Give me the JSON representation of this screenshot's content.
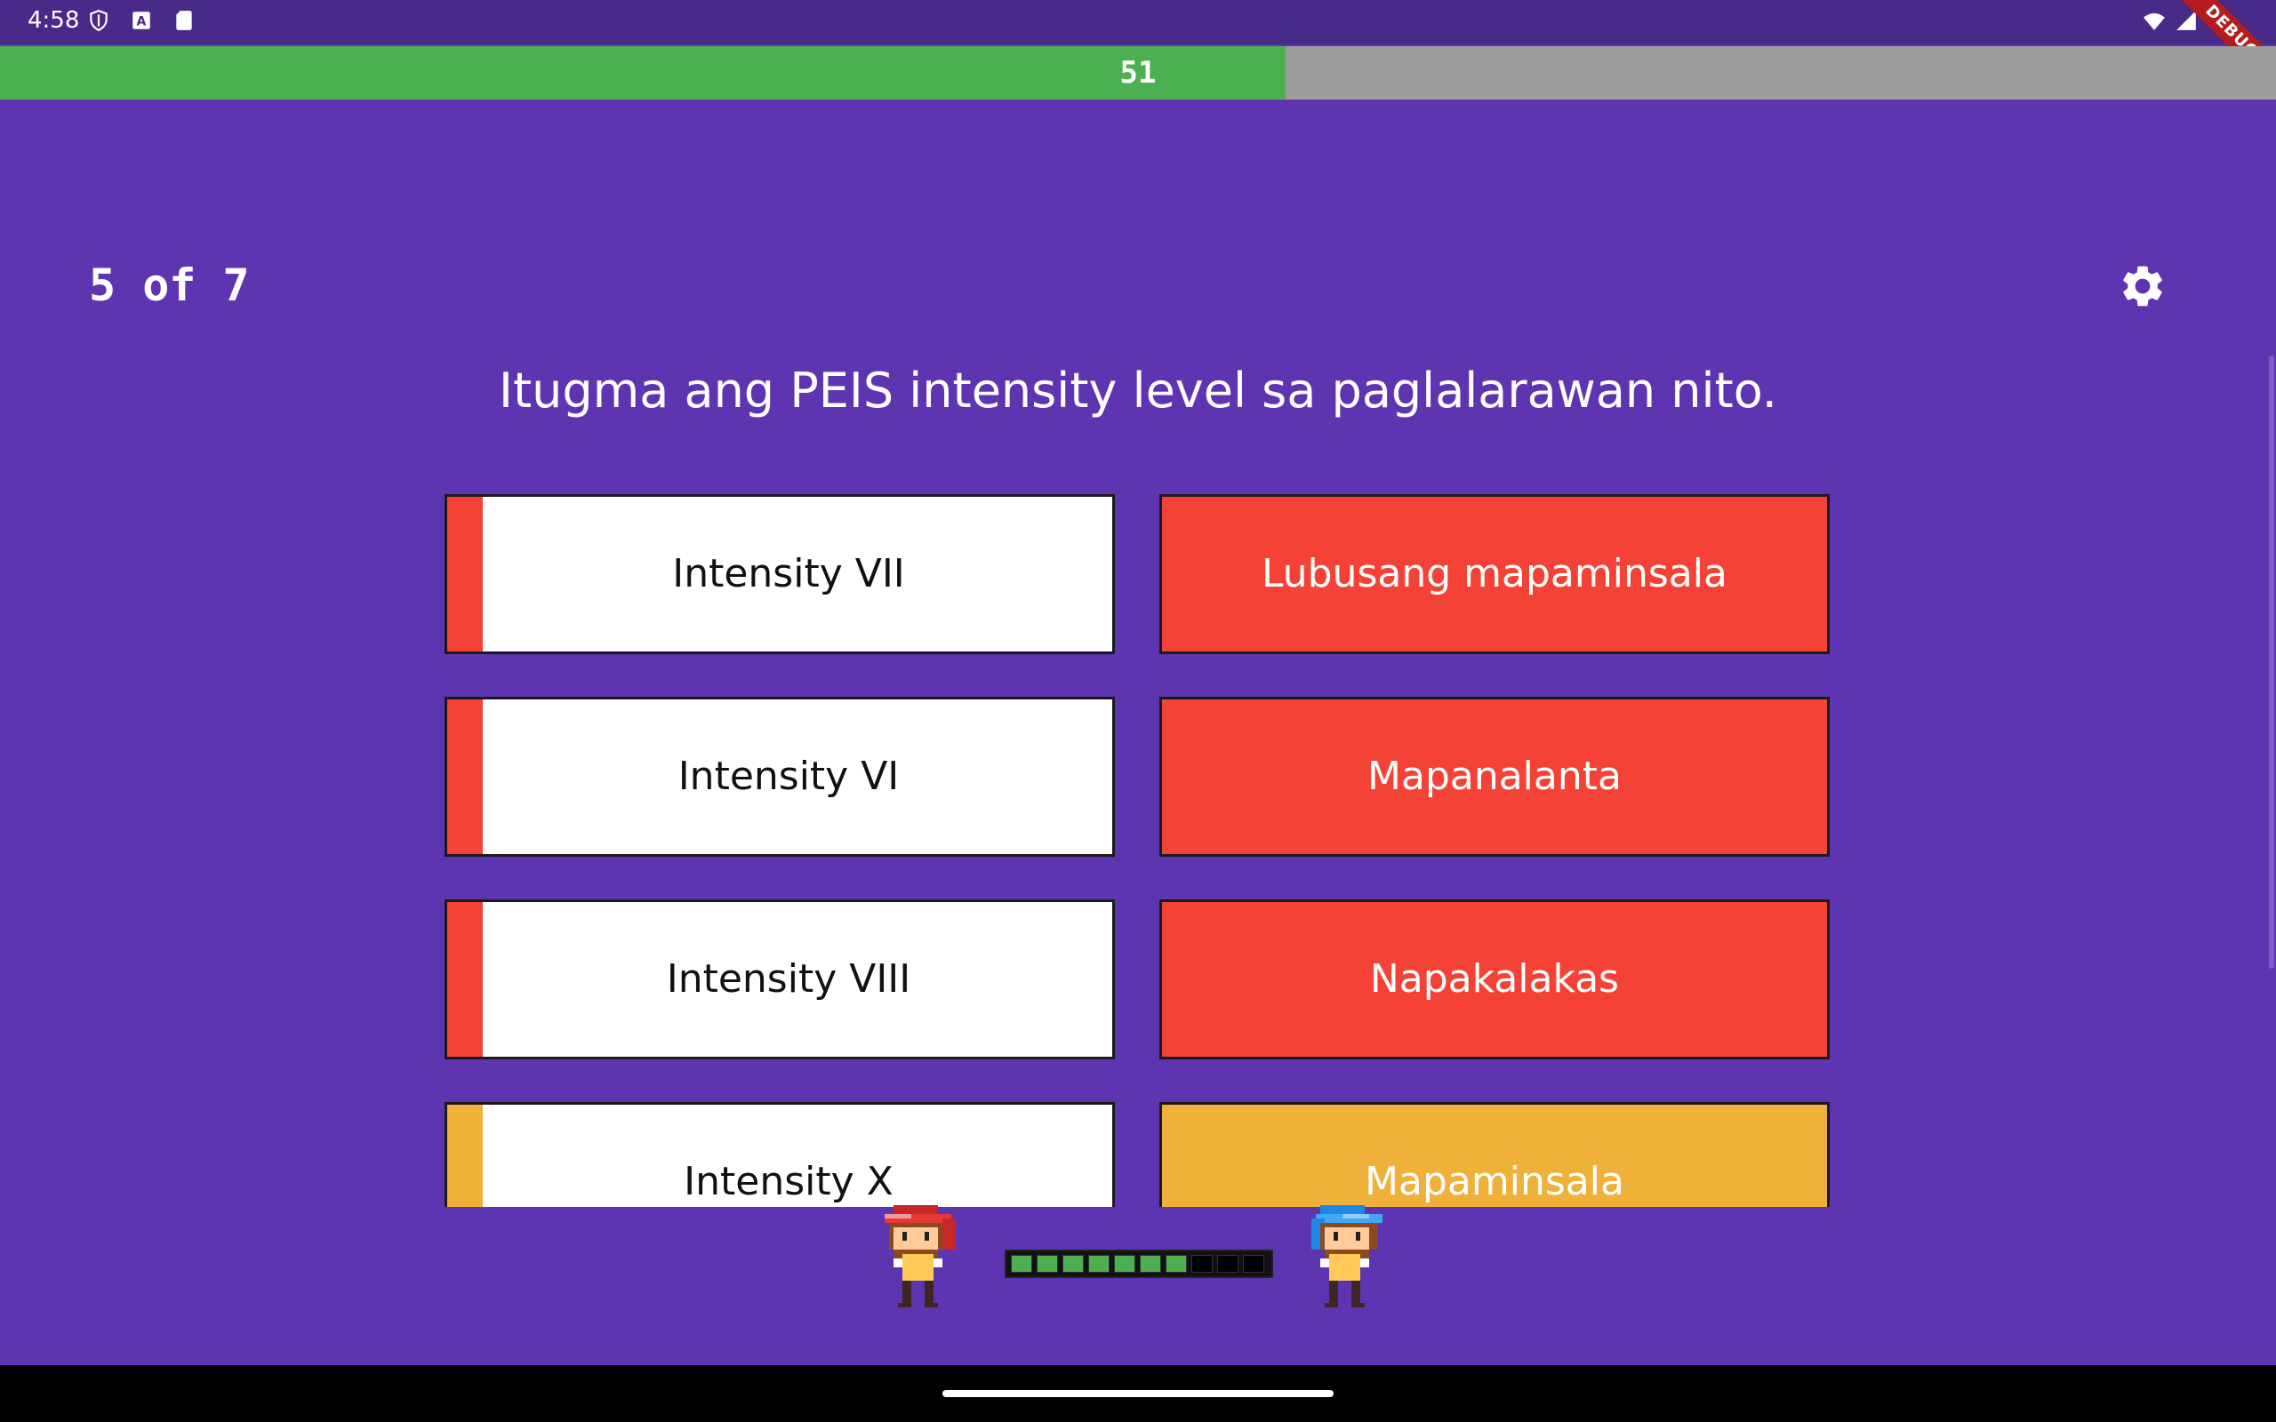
{
  "status_bar": {
    "time": "4:58",
    "debug_label": "DEBUG"
  },
  "timer": {
    "value": "51",
    "progress": 0.565
  },
  "header": {
    "counter": "5 of 7"
  },
  "question": "Itugma ang PEIS intensity level sa paglalarawan nito.",
  "colors": {
    "background": "#5e35b1",
    "red": "#f44336",
    "amber": "#f0b13b",
    "green": "#4caf50"
  },
  "left_cards": [
    {
      "label": "Intensity VII",
      "color": "#f44336"
    },
    {
      "label": "Intensity VI",
      "color": "#f44336"
    },
    {
      "label": "Intensity VIII",
      "color": "#f44336"
    },
    {
      "label": "Intensity X",
      "color": "#f0b13b"
    }
  ],
  "right_cards": [
    {
      "label": "Lubusang mapaminsala",
      "color": "#f44336"
    },
    {
      "label": "Mapanalanta",
      "color": "#f44336"
    },
    {
      "label": "Napakalakas",
      "color": "#f44336"
    },
    {
      "label": "Mapaminsala",
      "color": "#f0b13b"
    }
  ],
  "health": {
    "filled": 7,
    "total": 10
  },
  "icons": [
    "shield-icon",
    "a-icon",
    "sd-card-icon",
    "wifi-icon",
    "signal-icon",
    "battery-icon",
    "gear-icon"
  ]
}
